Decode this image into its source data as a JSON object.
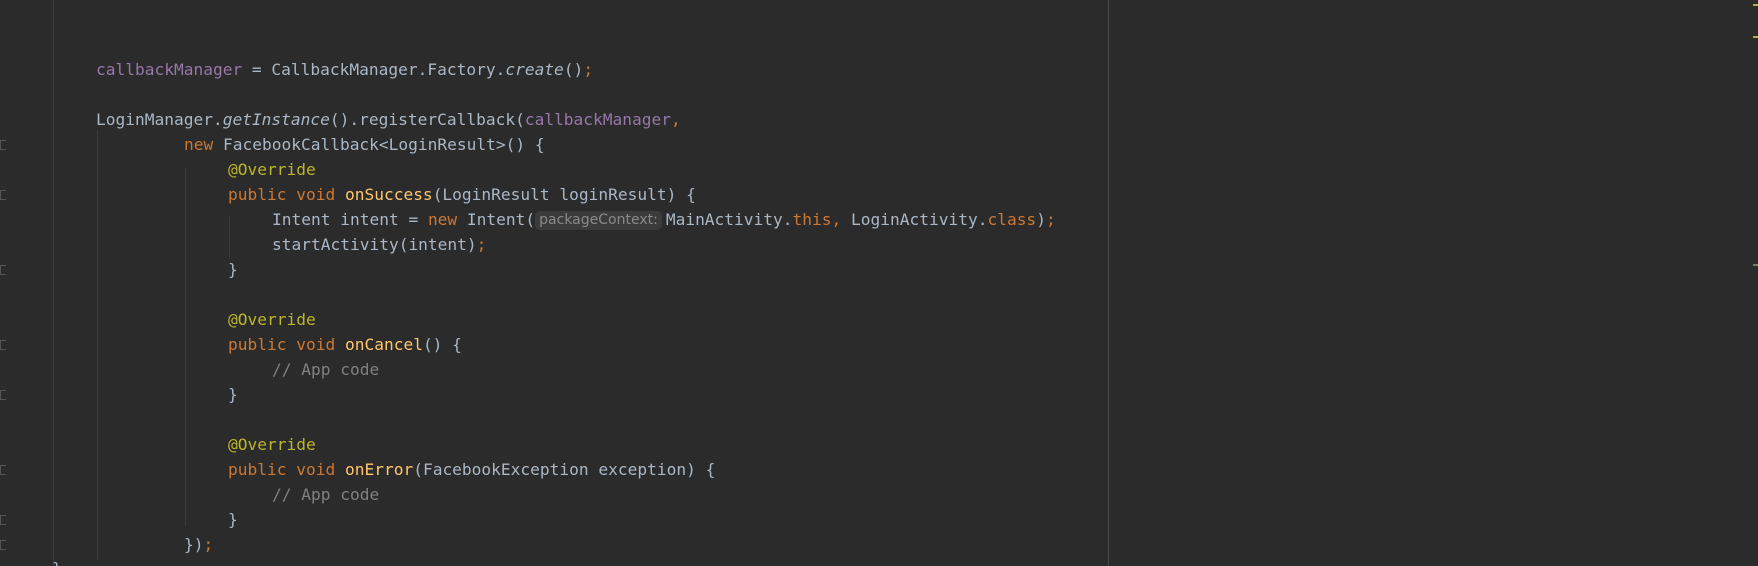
{
  "editor": {
    "lines": [
      {
        "var": "callbackManager",
        "rest1": " = CallbackManager.Factory.",
        "create": "create",
        "rest2": "()",
        "semi": ";"
      },
      {
        "t1": "LoginManager.",
        "getInstance": "getInstance",
        "t2": "().registerCallback(",
        "var": "callbackManager",
        "comma": ","
      },
      {
        "kw_new": "new",
        "t": " FacebookCallback<LoginResult>() {"
      },
      {
        "ann": "@Override"
      },
      {
        "kw_public": "public",
        "kw_void": "void",
        "fn": "onSuccess",
        "t": "(LoginResult loginResult) {"
      },
      {
        "t1": "Intent intent = ",
        "kw_new": "new",
        "t2": " Intent(",
        "hint": "packageContext:",
        "t3": "MainActivity.",
        "kw_this": "this",
        "comma": ",",
        "t4": " LoginActivity.",
        "kw_class": "class",
        "t5": ")",
        "semi": ";"
      },
      {
        "t": "startActivity(intent)",
        "semi": ";"
      },
      {
        "t": "}"
      },
      {
        "ann": "@Override"
      },
      {
        "kw_public": "public",
        "kw_void": "void",
        "fn": "onCancel",
        "t": "() {"
      },
      {
        "comment": "// App code"
      },
      {
        "t": "}"
      },
      {
        "ann": "@Override"
      },
      {
        "kw_public": "public",
        "kw_void": "void",
        "fn": "onError",
        "t": "(FacebookException exception) {"
      },
      {
        "comment": "// App code"
      },
      {
        "t": "}"
      },
      {
        "t": "})",
        "semi": ";"
      },
      {
        "t": "}"
      }
    ]
  },
  "colors": {
    "background": "#2b2b2b",
    "text": "#a9b7c6",
    "keyword": "#cc7832",
    "field": "#9876aa",
    "annotation": "#bbb529",
    "method_declaration": "#ffc66d",
    "comment": "#808080"
  }
}
